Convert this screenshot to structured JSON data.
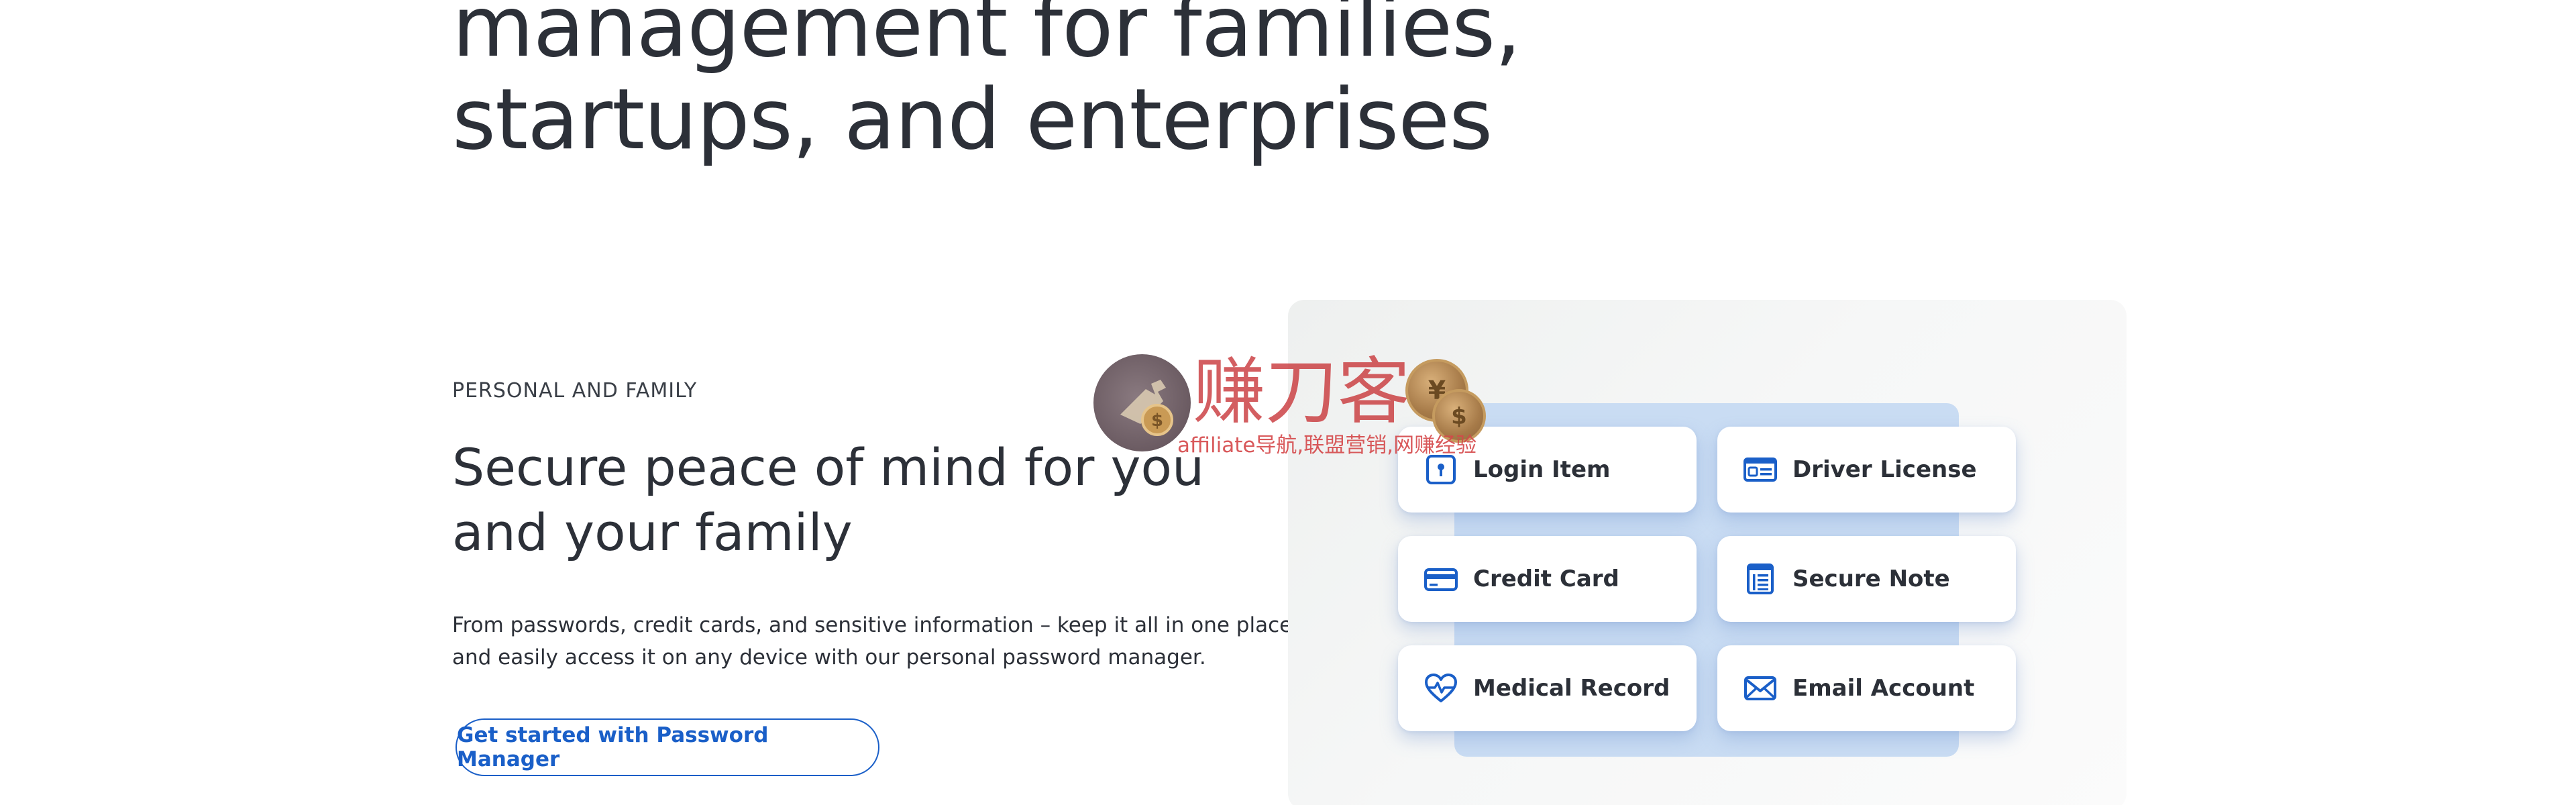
{
  "hero": {
    "line1": "management for families,",
    "line2": "startups, and enterprises"
  },
  "section": {
    "eyebrow": "PERSONAL AND FAMILY",
    "heading_line1": "Secure peace of mind for you",
    "heading_line2": "and your family",
    "body_line1": "From passwords, credit cards, and sensitive information – keep it all in one place",
    "body_line2": "and easily access it on any device with our personal password manager.",
    "cta_label": "Get started with Password Manager"
  },
  "vault_items": [
    {
      "label": "Login Item",
      "icon": "login-item-icon"
    },
    {
      "label": "Driver License",
      "icon": "driver-license-icon"
    },
    {
      "label": "Credit Card",
      "icon": "credit-card-icon"
    },
    {
      "label": "Secure Note",
      "icon": "secure-note-icon"
    },
    {
      "label": "Medical Record",
      "icon": "medical-record-icon"
    },
    {
      "label": "Email Account",
      "icon": "email-account-icon"
    }
  ],
  "watermark": {
    "title": "赚刀客",
    "subtitle": "affiliate导航,联盟营销,网赚经验"
  },
  "colors": {
    "accent": "#1a5fc8",
    "text": "#2c3038",
    "panel_card": "#c9dcf3",
    "icon": "#1a5fc8"
  }
}
